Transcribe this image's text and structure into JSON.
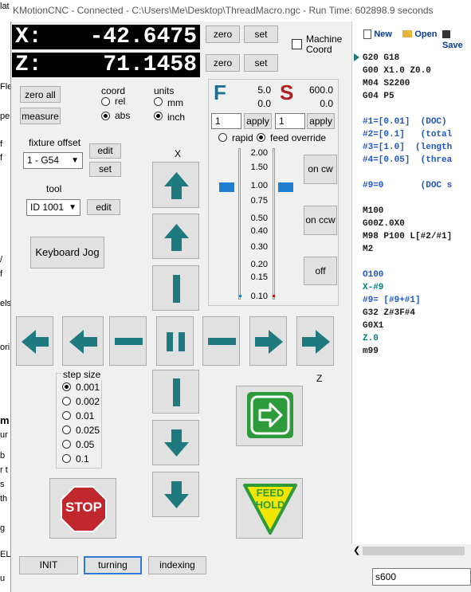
{
  "window": {
    "title": "KMotionCNC - Connected - C:\\Users\\Me\\Desktop\\ThreadMacro.ngc - Run Time: 602898.9 seconds"
  },
  "background_strip": {
    "fragments": [
      "lat",
      "Fle",
      "per",
      "f",
      "f",
      "/",
      "f",
      "els",
      "ori",
      "m",
      "ur",
      "b",
      "r t",
      "s",
      "th",
      "g",
      "EL",
      "u"
    ]
  },
  "dro": {
    "x": {
      "axis": "X:",
      "value": "-42.6475",
      "zero_label": "zero",
      "set_label": "set"
    },
    "z": {
      "axis": "Z:",
      "value": "71.1458",
      "zero_label": "zero",
      "set_label": "set"
    },
    "machine_coord_label": "Machine Coord",
    "machine_coord_checked": false
  },
  "buttons": {
    "zero_all": "zero all",
    "measure": "measure",
    "keyboard_jog": "Keyboard Jog",
    "fixture_edit": "edit",
    "fixture_set": "set",
    "tool_edit": "edit",
    "init": "INIT",
    "turning": "turning",
    "indexing": "indexing",
    "spindle_cw": "on cw",
    "spindle_ccw": "on ccw",
    "spindle_off": "off",
    "stop": "STOP",
    "feed_hold": "FEED HOLD"
  },
  "coord": {
    "label": "coord",
    "options": [
      "rel",
      "abs"
    ],
    "selected": "abs"
  },
  "units": {
    "label": "units",
    "options": [
      "mm",
      "inch"
    ],
    "selected": "inch"
  },
  "fixture_offset": {
    "label": "fixture offset",
    "value": "1 - G54"
  },
  "tool": {
    "label": "tool",
    "value": "ID 1001"
  },
  "axis_labels": {
    "x": "X",
    "z": "Z"
  },
  "step_size": {
    "label": "step size",
    "options": [
      "0.001",
      "0.002",
      "0.01",
      "0.025",
      "0.05",
      "0.1"
    ],
    "selected": "0.001"
  },
  "feed": {
    "letter": "F",
    "value": "5.0",
    "actual": "0.0",
    "input": "1",
    "apply_label": "apply",
    "color": "#1e6e8c"
  },
  "spindle": {
    "letter": "S",
    "value": "600.0",
    "actual": "0.0",
    "input": "1",
    "apply_label": "apply",
    "color": "#b01e1e"
  },
  "override_mode": {
    "options": [
      "rapid",
      "feed override"
    ],
    "selected": "feed override"
  },
  "override_scale": [
    "2.00",
    "1.50",
    "1.00",
    "0.75",
    "0.50",
    "0.40",
    "0.30",
    "0.20",
    "0.15",
    "0.10"
  ],
  "override": {
    "feed": "1.00",
    "spindle": "1.00"
  },
  "toolbar": {
    "new": "New",
    "open": "Open",
    "save": "Save"
  },
  "gcode": {
    "lines": [
      "G20 G18",
      "G00 X1.0 Z0.0",
      "M04 S2200",
      "G04 P5",
      "",
      "#1=[0.01]  (DOC)",
      "#2=[0.1]   (total",
      "#3=[1.0]  (length",
      "#4=[0.05]  (threa",
      "",
      "#9=0       (DOC s",
      "",
      "M100",
      "G00Z.0X0",
      "M98 P100 L[#2/#1]",
      "M2",
      "",
      "O100",
      "X-#9",
      "#9= [#9+#1]",
      "G32 Z#3F#4",
      "G0X1",
      "Z.0",
      "m99"
    ],
    "current_line": 0
  },
  "command": {
    "value": "s600"
  },
  "colors": {
    "dro_bg": "#000000",
    "jog_arrow": "#1f7a80",
    "stop_red": "#c0282e",
    "go_green": "#2e9b3a",
    "hold_yellow": "#f2e600"
  }
}
